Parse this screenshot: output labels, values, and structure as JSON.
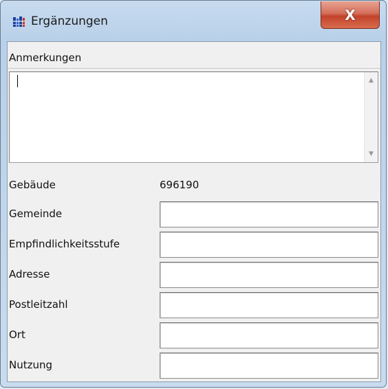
{
  "window": {
    "title": "Ergänzungen",
    "close_label": "X"
  },
  "notes": {
    "label": "Anmerkungen",
    "value": ""
  },
  "building": {
    "label": "Gebäude",
    "value": "696190"
  },
  "fields": [
    {
      "label": "Gemeinde",
      "value": ""
    },
    {
      "label": "Empfindlichkeitsstufe",
      "value": ""
    },
    {
      "label": "Adresse",
      "value": ""
    },
    {
      "label": "Postleitzahl",
      "value": ""
    },
    {
      "label": "Ort",
      "value": ""
    },
    {
      "label": "Nutzung",
      "value": ""
    }
  ],
  "icons": {
    "app": "app-grid-icon",
    "close": "close-icon",
    "scroll_up": "scroll-up-arrow-icon",
    "scroll_down": "scroll-down-arrow-icon"
  },
  "colors": {
    "close_button": "#c9482e",
    "client_bg": "#f0f0f0",
    "title_bar": "#b8d0e9"
  }
}
